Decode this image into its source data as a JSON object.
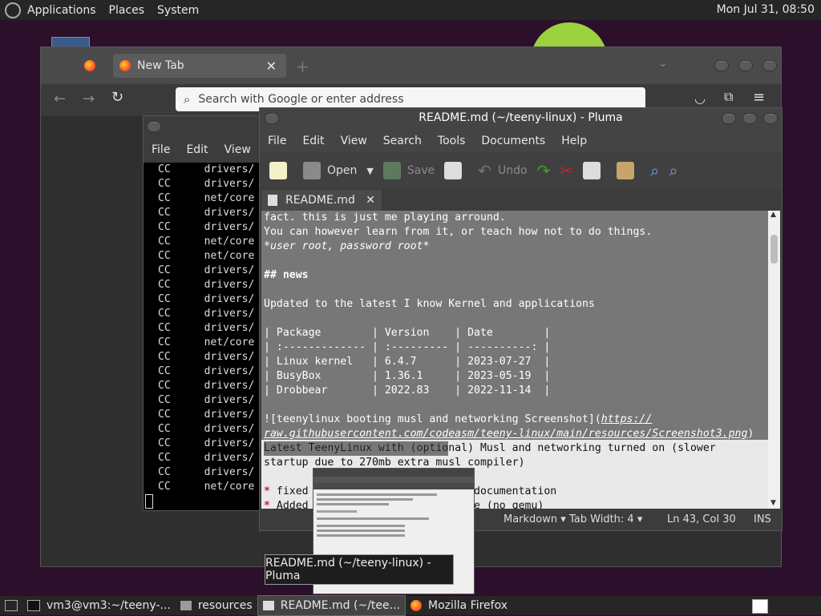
{
  "top_panel": {
    "menus": [
      "Applications",
      "Places",
      "System"
    ],
    "clock": "Mon Jul 31, 08:50"
  },
  "firefox": {
    "tab_title": "New Tab",
    "url_placeholder": "Search with Google or enter address",
    "window_title": "Mozilla Firefox"
  },
  "terminal": {
    "menu": [
      "File",
      "Edit",
      "View"
    ],
    "rows": [
      {
        "c": "CC",
        "p": "drivers/"
      },
      {
        "c": "CC",
        "p": "drivers/"
      },
      {
        "c": "CC",
        "p": "net/core"
      },
      {
        "c": "CC",
        "p": "drivers/"
      },
      {
        "c": "CC",
        "p": "drivers/"
      },
      {
        "c": "CC",
        "p": "net/core"
      },
      {
        "c": "CC",
        "p": "net/core"
      },
      {
        "c": "CC",
        "p": "drivers/"
      },
      {
        "c": "CC",
        "p": "drivers/"
      },
      {
        "c": "CC",
        "p": "drivers/"
      },
      {
        "c": "CC",
        "p": "drivers/"
      },
      {
        "c": "CC",
        "p": "drivers/"
      },
      {
        "c": "CC",
        "p": "net/core"
      },
      {
        "c": "CC",
        "p": "drivers/"
      },
      {
        "c": "CC",
        "p": "drivers/"
      },
      {
        "c": "CC",
        "p": "drivers/"
      },
      {
        "c": "CC",
        "p": "drivers/"
      },
      {
        "c": "CC",
        "p": "drivers/"
      },
      {
        "c": "CC",
        "p": "drivers/"
      },
      {
        "c": "CC",
        "p": "drivers/"
      },
      {
        "c": "CC",
        "p": "drivers/"
      },
      {
        "c": "CC",
        "p": "drivers/"
      },
      {
        "c": "CC",
        "p": "net/core"
      }
    ]
  },
  "pluma": {
    "title": "README.md (~/teeny-linux) - Pluma",
    "menu": [
      "File",
      "Edit",
      "View",
      "Search",
      "Tools",
      "Documents",
      "Help"
    ],
    "toolbar": {
      "open": "Open",
      "save": "Save",
      "undo": "Undo"
    },
    "tab_label": "README.md",
    "lines": [
      {
        "t": "fact. this is just me playing arround.",
        "sel": true
      },
      {
        "t": "You can however learn from it, or teach how not to do things.",
        "sel": true
      },
      {
        "t": "*user root, password root*",
        "sel": true,
        "em": true
      },
      {
        "t": "",
        "sel": true
      },
      {
        "t": "## news",
        "sel": true,
        "hdr": true
      },
      {
        "t": "",
        "sel": true
      },
      {
        "t": "Updated to the latest I know Kernel and applications",
        "sel": true
      },
      {
        "t": "",
        "sel": true
      },
      {
        "t": "| Package        | Version    | Date        |",
        "sel": true
      },
      {
        "t": "| :------------- | :--------- | ----------: |",
        "sel": true
      },
      {
        "t": "| Linux kernel   | 6.4.7      | 2023-07-27  |",
        "sel": true
      },
      {
        "t": "| BusyBox        | 1.36.1     | 2023-05-19  |",
        "sel": true
      },
      {
        "t": "| Drobbear       | 2022.83    | 2022-11-14  |",
        "sel": true
      },
      {
        "t": "",
        "sel": true
      },
      {
        "t": "![teenylinux booting musl and networking Screenshot](",
        "sel": true,
        "lnk_tail": "https://"
      },
      {
        "t": "",
        "sel": true,
        "lnk": "raw.githubusercontent.com/codeasm/teeny-linux/main/resources/Screenshot3.png",
        "tail": ")"
      },
      {
        "t": "Latest TeenyLinux with (optional) Musl and networking turned on (slower",
        "sel": false,
        "partsel": "Latest TeenyLinux with (optio"
      },
      {
        "t": "startup due to 270mb extra musl compiler)",
        "sel": false
      },
      {
        "t": "",
        "sel": false
      },
      {
        "t": " fixed               ipt, added documentation",
        "sel": false,
        "star": true
      },
      {
        "t": " Added               compile time (no qemu)",
        "sel": false,
        "star": true
      }
    ],
    "status": {
      "language": "Markdown",
      "tab_width": "Tab Width: 4",
      "position": "Ln 43, Col 30",
      "mode": "INS"
    }
  },
  "preview": {
    "tooltip": "README.md (~/teeny-linux) - Pluma"
  },
  "taskbar": {
    "items": [
      "vm3@vm3:~/teeny-...",
      "resources",
      "README.md (~/tee...",
      "Mozilla Firefox"
    ]
  }
}
